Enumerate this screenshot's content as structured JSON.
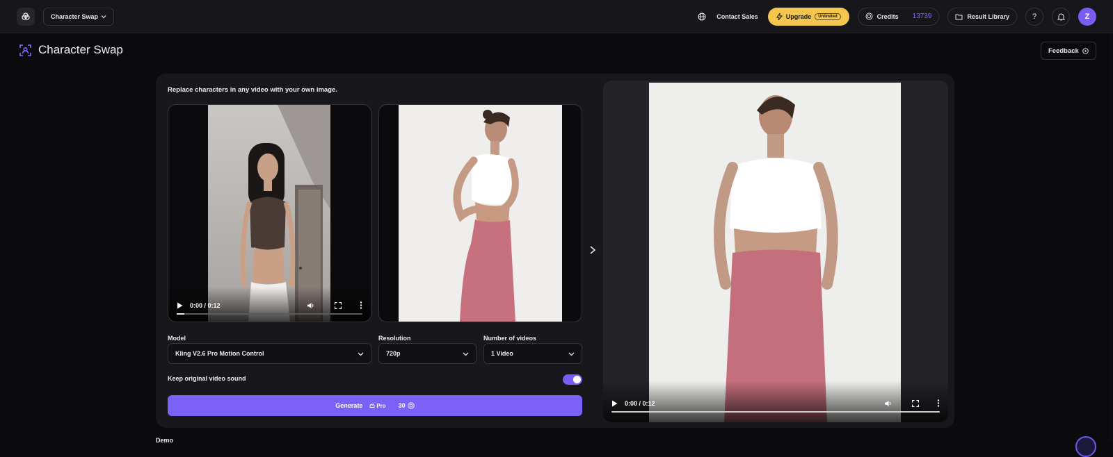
{
  "topbar": {
    "app_switch_label": "Character Swap",
    "contact_label": "Contact Sales",
    "upgrade_label": "Upgrade",
    "upgrade_badge": "Unlimited",
    "credits_label": "Credits",
    "credits_value": "13739",
    "library_label": "Result Library",
    "help_label": "?",
    "avatar_initial": "Z"
  },
  "page": {
    "title": "Character Swap",
    "feedback_label": "Feedback",
    "intro": "Replace characters in any video with your own image."
  },
  "source_video": {
    "time": "0:00 / 0:12",
    "progress": 0.04
  },
  "settings": {
    "model_label": "Model",
    "model_value": "Kling V2.6 Pro Motion Control",
    "resolution_label": "Resolution",
    "resolution_value": "720p",
    "count_label": "Number of videos",
    "count_value": "1 Video",
    "sound_label": "Keep original video sound",
    "sound_on": true
  },
  "generate": {
    "label": "Generate",
    "tier": "Pro",
    "cost": "30"
  },
  "result_video": {
    "time": "0:00 / 0:12",
    "progress": 0.0
  },
  "demo_label": "Demo",
  "colors": {
    "accent": "#7b61f8",
    "upgrade": "#f5c64f",
    "panel": "#18181c"
  },
  "icons": [
    "app-logo-icon",
    "chevron-down-icon",
    "globe-icon",
    "bolt-icon",
    "coin-icon",
    "folder-icon",
    "bell-icon",
    "character-swap-icon",
    "feedback-icon",
    "play-icon",
    "volume-icon",
    "fullscreen-icon",
    "more-icon",
    "lock-icon",
    "chevron-right-icon"
  ]
}
